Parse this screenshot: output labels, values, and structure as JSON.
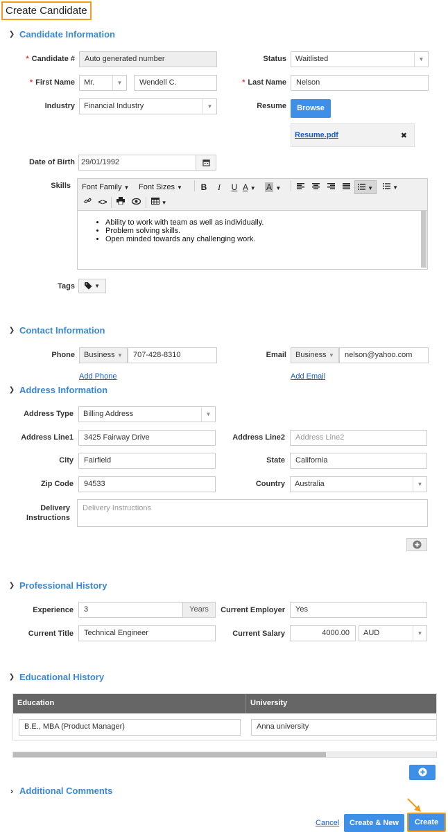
{
  "page_title": "Create Candidate",
  "sections": {
    "candidate_info": "Candidate Information",
    "contact_info": "Contact Information",
    "address_info": "Address Information",
    "professional_history": "Professional History",
    "educational_history": "Educational History",
    "additional_comments": "Additional Comments"
  },
  "candidate": {
    "candidate_no_label": "Candidate #",
    "candidate_no_value": "Auto generated number",
    "status_label": "Status",
    "status_value": "Waitlisted",
    "first_name_label": "First Name",
    "salutation": "Mr.",
    "first_name": "Wendell C.",
    "last_name_label": "Last Name",
    "last_name": "Nelson",
    "industry_label": "Industry",
    "industry": "Financial Industry",
    "resume_label": "Resume",
    "browse_label": "Browse",
    "resume_file": "Resume.pdf",
    "remove_icon": "✖",
    "dob_label": "Date of Birth",
    "dob": "29/01/1992",
    "skills_label": "Skills",
    "tags_label": "Tags"
  },
  "editor": {
    "font_family": "Font Family",
    "font_sizes": "Font Sizes",
    "bold": "B",
    "italic": "I",
    "underline": "U",
    "font_color": "A",
    "bg_color": "A",
    "skills": [
      "Ability to work with team as well as individually.",
      "Problem solving skills.",
      "Open minded towards any challenging work."
    ]
  },
  "contact": {
    "phone_label": "Phone",
    "phone_type": "Business",
    "phone": "707-428-8310",
    "email_label": "Email",
    "email_type": "Business",
    "email": "nelson@yahoo.com",
    "add_phone": "Add Phone",
    "add_email": "Add Email"
  },
  "address": {
    "type_label": "Address Type",
    "type_value": "Billing Address",
    "line1_label": "Address Line1",
    "line1": "3425 Fairway Drive",
    "line2_label": "Address Line2",
    "line2_placeholder": "Address Line2",
    "city_label": "City",
    "city": "Fairfield",
    "state_label": "State",
    "state": "California",
    "zip_label": "Zip Code",
    "zip": "94533",
    "country_label": "Country",
    "country": "Australia",
    "delivery_label_1": "Delivery",
    "delivery_label_2": "Instructions",
    "delivery_placeholder": "Delivery Instructions"
  },
  "professional": {
    "experience_label": "Experience",
    "experience": "3",
    "experience_unit": "Years",
    "employer_label": "Current Employer",
    "employer": "Yes",
    "title_label": "Current Title",
    "title": "Technical Engineer",
    "salary_label": "Current Salary",
    "salary": "4000.00",
    "currency": "AUD"
  },
  "education": {
    "columns": [
      "Education",
      "University"
    ],
    "rows": [
      [
        "B.E., MBA (Product Manager)",
        "Anna university"
      ]
    ],
    "scroll_fraction": 0.74
  },
  "footer": {
    "cancel": "Cancel",
    "create_new": "Create & New",
    "create": "Create"
  },
  "colors": {
    "accent": "#3d8fe8",
    "section_title": "#3a87d6",
    "highlight": "#f29b1d",
    "required": "#e03c3c"
  }
}
